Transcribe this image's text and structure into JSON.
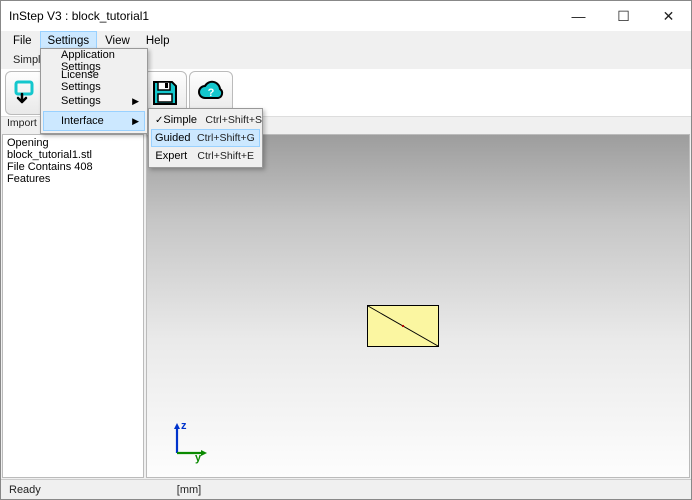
{
  "window": {
    "title": "InStep V3 : block_tutorial1"
  },
  "winbtns": {
    "min": "—",
    "max": "☐",
    "close": "✕"
  },
  "menus": {
    "file": "File",
    "settings": "Settings",
    "view": "View",
    "help": "Help"
  },
  "tabstrip": {
    "simple": "Simple"
  },
  "dropdown": {
    "app_settings": "Application Settings",
    "license_settings": "License Settings",
    "settings": "Settings",
    "interface": "Interface"
  },
  "submenu": {
    "simple": {
      "label": "Simple",
      "accel": "Ctrl+Shift+S",
      "checked": true
    },
    "guided": {
      "label": "Guided",
      "accel": "Ctrl+Shift+G",
      "checked": false
    },
    "expert": {
      "label": "Expert",
      "accel": "Ctrl+Shift+E",
      "checked": false
    }
  },
  "toolbar_caption_row": "Import      Repair      Features",
  "log": {
    "l1": "Opening",
    "l2": "block_tutorial1.stl",
    "l3": "File Contains 408",
    "l4": "Features"
  },
  "axis": {
    "z": "z",
    "y": "y"
  },
  "status": {
    "ready": "Ready",
    "units": "[mm]"
  },
  "colors": {
    "accent": "#14c7cd"
  }
}
